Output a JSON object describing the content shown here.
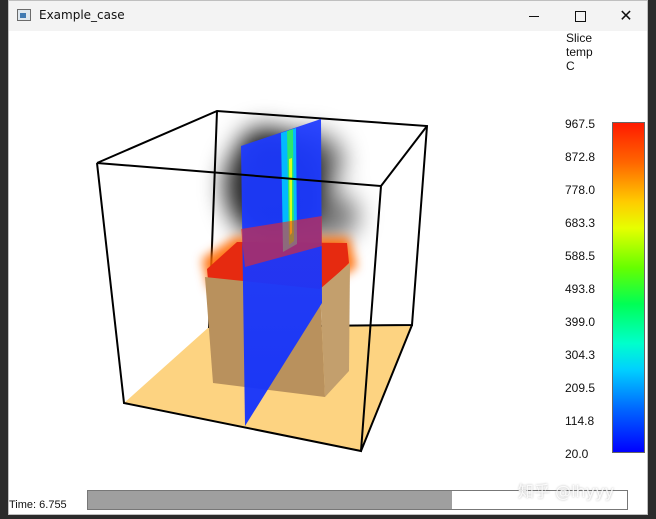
{
  "window": {
    "title": "Example_case"
  },
  "controls": {
    "minimize": "—",
    "maximize": "☐",
    "close": "✕"
  },
  "colorbar": {
    "title": [
      "Slice",
      "temp",
      "C"
    ],
    "labels": [
      "967.5",
      "872.8",
      "778.0",
      "683.3",
      "588.5",
      "493.8",
      "399.0",
      "304.3",
      "209.5",
      "114.8",
      "20.0"
    ]
  },
  "status": {
    "time": "Time: 6.755",
    "progress_fraction": 0.675
  },
  "watermark": "知乎 @lhyyy",
  "icons": {
    "app": "app-window-icon",
    "minimize": "minimize-icon",
    "maximize": "maximize-icon",
    "close": "close-icon"
  }
}
